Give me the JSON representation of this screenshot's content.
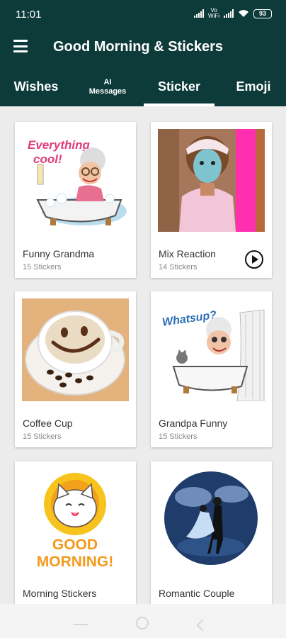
{
  "status_bar": {
    "time": "11:01",
    "network_label": "Vo\nWiFi",
    "battery": "93"
  },
  "app_bar": {
    "title": "Good Morning & Stickers"
  },
  "tabs": [
    {
      "label": "Wishes"
    },
    {
      "label": "AI\nMessages"
    },
    {
      "label": "Sticker",
      "selected": true
    },
    {
      "label": "Emoji"
    }
  ],
  "colors": {
    "primary": "#0d3b3a",
    "indicator": "#ffffff",
    "background": "#ececec"
  },
  "packs": [
    {
      "name": "Funny Grandma",
      "count": "15 Stickers",
      "image": "grandma-bathtub-sticker",
      "sticker_text": "Everything cool!"
    },
    {
      "name": "Mix Reaction",
      "count": "14 Stickers",
      "image": "face-mask-woman-photo",
      "has_play": true
    },
    {
      "name": "Coffee Cup",
      "count": "15 Stickers",
      "image": "smiley-coffee-cup-photo"
    },
    {
      "name": "Grandpa Funny",
      "count": "15 Stickers",
      "image": "grandpa-bathtub-sticker",
      "sticker_text": "Whatsup?"
    },
    {
      "name": "Morning Stickers",
      "count": "",
      "image": "cat-sunflower-sticker",
      "sticker_text": "GOOD\nMORNING!"
    },
    {
      "name": "Romantic Couple",
      "count": "",
      "image": "dancing-couple-sticker"
    }
  ]
}
